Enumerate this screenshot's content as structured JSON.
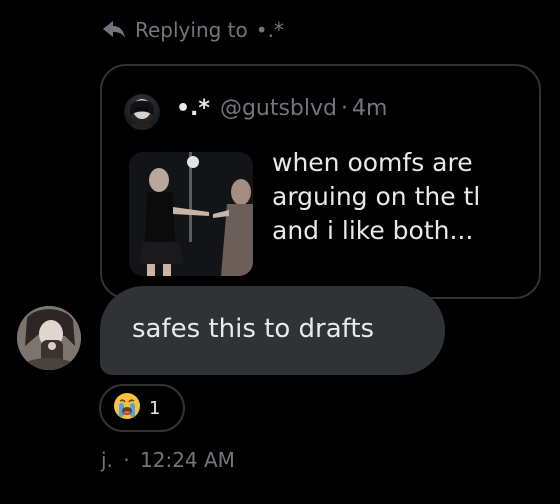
{
  "reply": {
    "prefix": "Replying to",
    "target": "•.*"
  },
  "quote": {
    "display_name": "•.*",
    "handle": "@gutsblvd",
    "separator": "·",
    "time": "4m",
    "text": "when oomfs are arguing on the tl and i like both..."
  },
  "message": {
    "text": "safes this to drafts"
  },
  "reaction": {
    "icon": "loudly-crying-face-emoji",
    "count": "1"
  },
  "footer": {
    "sender": "j.",
    "separator": "·",
    "time": "12:24 AM"
  },
  "colors": {
    "background": "#000000",
    "bubble": "#2f3336",
    "border": "#2f3336",
    "muted_text": "#71767b",
    "primary_text": "#e7e9ea"
  }
}
